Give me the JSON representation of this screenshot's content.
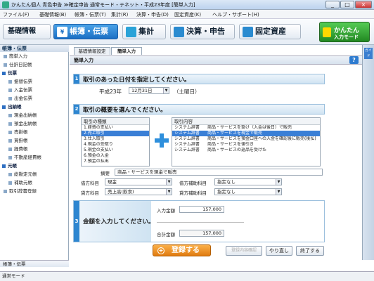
{
  "window": {
    "title": "かんたん個人 青色申告 ≫確定申告 通常モード・テネット・平成23年度 [簡単入力]",
    "min": "_",
    "max": "□",
    "close": "×"
  },
  "menu": [
    "ファイル(F)",
    "基礎情報(B)",
    "帳簿・伝票(T)",
    "集計(R)",
    "決算・申告(D)",
    "固定資産(K)",
    "ヘルプ・サポート(H)"
  ],
  "toolbar": {
    "basic": "基礎情報",
    "books": "帳簿・伝票",
    "summary": "集計",
    "closing": "決算・申告",
    "assets": "固定資産",
    "easy_mode_1": "かんたん",
    "easy_mode_2": "入力モード",
    "colors": {
      "basic": "#3a76c4",
      "books": "#1b6fc4",
      "summary": "#2aa3d8",
      "closing": "#2a8bd0",
      "assets": "#2a8bd0",
      "easy": "#2c9a2c"
    }
  },
  "sidebar": {
    "title": "帳簿・伝票",
    "items": [
      {
        "label": "簡単入力",
        "level": 1,
        "kind": "item"
      },
      {
        "label": "仕訳日記帳",
        "level": 1,
        "kind": "item"
      },
      {
        "label": "伝票",
        "level": 0,
        "kind": "section"
      },
      {
        "label": "振替伝票",
        "level": 2,
        "kind": "item"
      },
      {
        "label": "入金伝票",
        "level": 2,
        "kind": "item"
      },
      {
        "label": "出金伝票",
        "level": 2,
        "kind": "item"
      },
      {
        "label": "出納帳",
        "level": 0,
        "kind": "section"
      },
      {
        "label": "現金出納帳",
        "level": 2,
        "kind": "item"
      },
      {
        "label": "預金出納帳",
        "level": 2,
        "kind": "item"
      },
      {
        "label": "売掛帳",
        "level": 2,
        "kind": "item"
      },
      {
        "label": "買掛帳",
        "level": 2,
        "kind": "item"
      },
      {
        "label": "経費帳",
        "level": 2,
        "kind": "item"
      },
      {
        "label": "不動産経費帳",
        "level": 2,
        "kind": "item"
      },
      {
        "label": "元帳",
        "level": 0,
        "kind": "section"
      },
      {
        "label": "総勘定元帳",
        "level": 2,
        "kind": "item"
      },
      {
        "label": "補助元帳",
        "level": 2,
        "kind": "item"
      },
      {
        "label": "取引辞書登録",
        "level": 1,
        "kind": "item"
      }
    ],
    "footer": "帳簿・伝票"
  },
  "tabs": [
    "基礎情報設定",
    "簡単入力"
  ],
  "page_title": "簡単入力",
  "help": "?",
  "right_tab": "ガイド",
  "step1": {
    "num": "1",
    "title": "取引のあった日付を指定してください。",
    "era": "平成23年",
    "date": "12月31日",
    "weekday": "（土曜日）"
  },
  "step2": {
    "num": "2",
    "title": "取引の概要を選んでください。",
    "types_header": "取引の種類",
    "types": [
      "1.経費の支払い",
      "2.売上取引",
      "3.仕入取引",
      "4.現金の受取り",
      "5.現金の支払い",
      "6.預金の入金",
      "7.預金の払出"
    ],
    "selected_type": 1,
    "contents_header": "取引内容",
    "contents": [
      {
        "cat": "システム辞書",
        "text": "商品・サービスを掛け（入金は後日）で販売"
      },
      {
        "cat": "システム辞書",
        "text": "商品・サービスを現金で販売"
      },
      {
        "cat": "システム辞書",
        "text": "商品・サービスを預金口座への入金を確認後に販売(後払)"
      },
      {
        "cat": "システム辞書",
        "text": "商品・サービスを値引き"
      },
      {
        "cat": "システム辞書",
        "text": "商品・サービスの返品を受けた"
      }
    ],
    "selected_content": 1,
    "summary_label": "摘要",
    "summary_value": "商品・サービスを現金で販売",
    "debit_label": "借方科目",
    "debit_value": "現金",
    "credit_label": "貸方科目",
    "credit_value": "売上高(飲食)",
    "debit_sub_label": "借方補助科目",
    "debit_sub_value": "指定なし",
    "credit_sub_label": "貸方補助科目",
    "credit_sub_value": "指定なし"
  },
  "step3": {
    "num": "3",
    "title": "金額を入力してください。",
    "input_label": "入力金額",
    "input_value": "157,000",
    "total_label": "合計金額",
    "total_value": "157,000"
  },
  "actions": {
    "register": "登録する",
    "confirm": "登録内容確認",
    "redo": "やり直し",
    "close": "終了する"
  },
  "status": "通常モード"
}
